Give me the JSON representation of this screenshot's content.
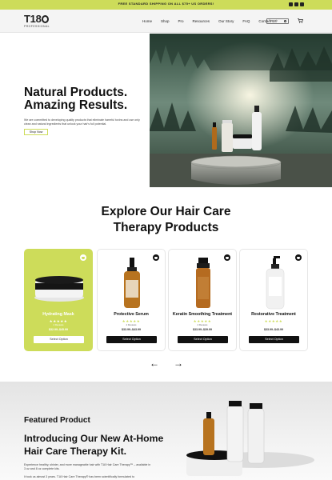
{
  "announcement": {
    "text": "FREE STANDARD SHIPPING ON ALL $75+ US ORDERS!"
  },
  "brand": {
    "logo": "T18",
    "tagline": "PROFESSIONAL"
  },
  "nav": {
    "items": [
      {
        "label": "Home"
      },
      {
        "label": "Shop"
      },
      {
        "label": "Pro"
      },
      {
        "label": "Resources"
      },
      {
        "label": "Our Story"
      },
      {
        "label": "FAQ"
      },
      {
        "label": "Contact Us"
      }
    ],
    "search_placeholder": "Search"
  },
  "hero": {
    "title_line1": "Natural Products.",
    "title_line2": "Amazing Results.",
    "description": "We are committed to developing quality products that eliminate harmful toxins and use only clean and natural ingredients that unlock your hair's full potential.",
    "button": "Shop Now"
  },
  "products_section": {
    "title_line1": "Explore Our Hair Care",
    "title_line2": "Therapy Products",
    "products": [
      {
        "name": "Hydrating Mask",
        "stars": "★★★★★",
        "reviews": "4 Reviews",
        "price": "$32.99–$45.99",
        "button": "Select Option"
      },
      {
        "name": "Protective Serum",
        "stars": "★★★★★",
        "reviews": "4 Reviews",
        "price": "$33.99–$43.99",
        "button": "Select Option"
      },
      {
        "name": "Keratin Smoothing Treatment",
        "stars": "★★★★★",
        "reviews": "4 Reviews",
        "price": "$33.99–$39.99",
        "button": "Select Option"
      },
      {
        "name": "Restorative Treatment",
        "stars": "★★★★★",
        "reviews": "",
        "price": "$33.99–$43.99",
        "button": "Select Option"
      }
    ],
    "prev_arrow": "←",
    "next_arrow": "→"
  },
  "featured": {
    "label": "Featured Product",
    "title_line1": "Introducing Our New At-Home",
    "title_line2": "Hair Care Therapy Kit.",
    "description": "Experience healthy, shinier, and more manageable hair with T18 Hair Care Therapy™ – available in 3 oz and 8 oz complete kits.",
    "description2": "It took us almost 3 years. T18 Hair Care Therapy® has been scientifically formulated to"
  },
  "colors": {
    "accent": "#cddc5a",
    "dark": "#111111"
  }
}
